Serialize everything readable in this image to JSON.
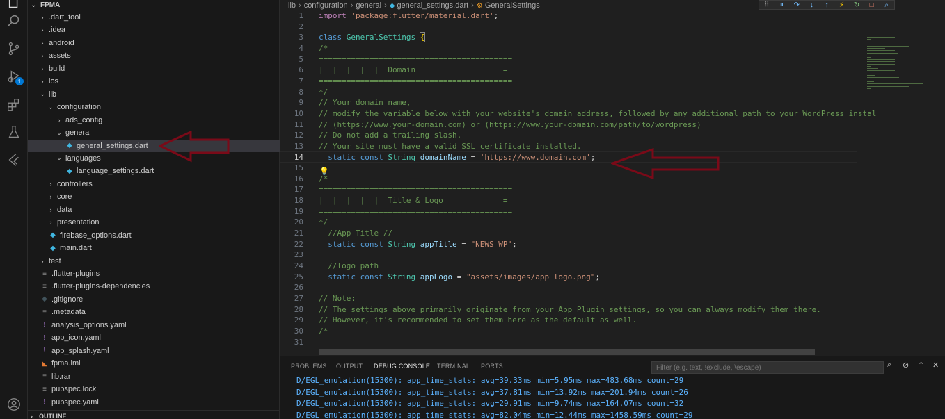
{
  "explorer": {
    "root": "FPMA",
    "outline_label": "OUTLINE",
    "items": [
      {
        "label": ".dart_tool",
        "type": "folder",
        "state": "collapsed",
        "depth": 1
      },
      {
        "label": ".idea",
        "type": "folder",
        "state": "collapsed",
        "depth": 1
      },
      {
        "label": "android",
        "type": "folder",
        "state": "collapsed",
        "depth": 1
      },
      {
        "label": "assets",
        "type": "folder",
        "state": "collapsed",
        "depth": 1
      },
      {
        "label": "build",
        "type": "folder",
        "state": "collapsed",
        "depth": 1
      },
      {
        "label": "ios",
        "type": "folder",
        "state": "collapsed",
        "depth": 1
      },
      {
        "label": "lib",
        "type": "folder",
        "state": "expanded",
        "depth": 1
      },
      {
        "label": "configuration",
        "type": "folder",
        "state": "expanded",
        "depth": 2
      },
      {
        "label": "ads_config",
        "type": "folder",
        "state": "collapsed",
        "depth": 3
      },
      {
        "label": "general",
        "type": "folder",
        "state": "expanded",
        "depth": 3
      },
      {
        "label": "general_settings.dart",
        "type": "dart",
        "depth": 4,
        "selected": true
      },
      {
        "label": "languages",
        "type": "folder",
        "state": "expanded",
        "depth": 3
      },
      {
        "label": "language_settings.dart",
        "type": "dart",
        "depth": 4
      },
      {
        "label": "controllers",
        "type": "folder",
        "state": "collapsed",
        "depth": 2
      },
      {
        "label": "core",
        "type": "folder",
        "state": "collapsed",
        "depth": 2
      },
      {
        "label": "data",
        "type": "folder",
        "state": "collapsed",
        "depth": 2
      },
      {
        "label": "presentation",
        "type": "folder",
        "state": "collapsed",
        "depth": 2
      },
      {
        "label": "firebase_options.dart",
        "type": "dart",
        "depth": 2
      },
      {
        "label": "main.dart",
        "type": "dart",
        "depth": 2
      },
      {
        "label": "test",
        "type": "folder",
        "state": "collapsed",
        "depth": 1
      },
      {
        "label": ".flutter-plugins",
        "type": "text",
        "depth": 1
      },
      {
        "label": ".flutter-plugins-dependencies",
        "type": "text",
        "depth": 1
      },
      {
        "label": ".gitignore",
        "type": "git",
        "depth": 1
      },
      {
        "label": ".metadata",
        "type": "text",
        "depth": 1
      },
      {
        "label": "analysis_options.yaml",
        "type": "yaml",
        "depth": 1
      },
      {
        "label": "app_icon.yaml",
        "type": "yaml",
        "depth": 1
      },
      {
        "label": "app_splash.yaml",
        "type": "yaml",
        "depth": 1
      },
      {
        "label": "fpma.iml",
        "type": "rss",
        "depth": 1
      },
      {
        "label": "lib.rar",
        "type": "text",
        "depth": 1
      },
      {
        "label": "pubspec.lock",
        "type": "text",
        "depth": 1
      },
      {
        "label": "pubspec.yaml",
        "type": "yaml",
        "depth": 1
      }
    ]
  },
  "breadcrumb": {
    "parts": [
      "lib",
      "configuration",
      "general",
      "general_settings.dart",
      "GeneralSettings"
    ]
  },
  "editor": {
    "active_line": 14,
    "lines": [
      [
        [
          "kw2",
          "import "
        ],
        [
          "str",
          "'package:flutter/material.dart'"
        ],
        [
          "pl",
          ";"
        ]
      ],
      [],
      [
        [
          "kw",
          "class "
        ],
        [
          "cls",
          "GeneralSettings "
        ],
        [
          "brk",
          "{"
        ]
      ],
      [
        [
          "cmt",
          "/*"
        ]
      ],
      [
        [
          "cmt",
          "=========================================="
        ]
      ],
      [
        [
          "cmt",
          "|  |  |  |  |  Domain                   ="
        ]
      ],
      [
        [
          "cmt",
          "=========================================="
        ]
      ],
      [
        [
          "cmt",
          "*/"
        ]
      ],
      [
        [
          "cmt",
          "// Your domain name,"
        ]
      ],
      [
        [
          "cmt",
          "// modify the variable below with your website's domain address, followed by any additional path to your WordPress instal"
        ]
      ],
      [
        [
          "cmt",
          "// (https://www.your-domain.com) or (https://www.your-domain.com/path/to/wordpress)"
        ]
      ],
      [
        [
          "cmt",
          "// Do not add a trailing slash."
        ]
      ],
      [
        [
          "cmt",
          "// Your site must have a valid SSL certificate installed."
        ]
      ],
      [
        [
          "pl",
          "  "
        ],
        [
          "kw",
          "static const "
        ],
        [
          "cls",
          "String "
        ],
        [
          "var",
          "domainName "
        ],
        [
          "pl",
          "= "
        ],
        [
          "str",
          "'https://www.domain.com'"
        ],
        [
          "pl",
          ";"
        ]
      ],
      [],
      [
        [
          "cmt",
          "/*"
        ]
      ],
      [
        [
          "cmt",
          "=========================================="
        ]
      ],
      [
        [
          "cmt",
          "|  |  |  |  |  Title & Logo             ="
        ]
      ],
      [
        [
          "cmt",
          "=========================================="
        ]
      ],
      [
        [
          "cmt",
          "*/"
        ]
      ],
      [
        [
          "cmt",
          "  //App Title //"
        ]
      ],
      [
        [
          "pl",
          "  "
        ],
        [
          "kw",
          "static const "
        ],
        [
          "cls",
          "String "
        ],
        [
          "var",
          "appTitle "
        ],
        [
          "pl",
          "= "
        ],
        [
          "str",
          "\"NEWS WP\""
        ],
        [
          "pl",
          ";"
        ]
      ],
      [],
      [
        [
          "cmt",
          "  //logo path"
        ]
      ],
      [
        [
          "pl",
          "  "
        ],
        [
          "kw",
          "static const "
        ],
        [
          "cls",
          "String "
        ],
        [
          "var",
          "appLogo "
        ],
        [
          "pl",
          "= "
        ],
        [
          "str",
          "\"assets/images/app_logo.png\""
        ],
        [
          "pl",
          ";"
        ]
      ],
      [],
      [
        [
          "cmt",
          "// Note:"
        ]
      ],
      [
        [
          "cmt",
          "// The settings above primarily originate from your App Plugin settings, so you can always modify them there."
        ]
      ],
      [
        [
          "cmt",
          "// However, it's recommended to set them here as the default as well."
        ]
      ],
      [
        [
          "cmt",
          "/*"
        ]
      ],
      []
    ]
  },
  "panel": {
    "tabs": [
      "PROBLEMS",
      "OUTPUT",
      "DEBUG CONSOLE",
      "TERMINAL",
      "PORTS"
    ],
    "active_tab": "DEBUG CONSOLE",
    "filter_placeholder": "Filter (e.g. text, !exclude, \\escape)",
    "console_lines": [
      "D/EGL_emulation(15300): app_time_stats: avg=39.33ms min=5.95ms max=483.68ms count=29",
      "D/EGL_emulation(15300): app_time_stats: avg=37.81ms min=13.92ms max=201.94ms count=26",
      "D/EGL_emulation(15300): app_time_stats: avg=29.91ms min=9.74ms max=164.07ms count=32",
      "D/EGL_emulation(15300): app_time_stats: avg=82.04ms min=12.44ms max=1458.59ms count=29"
    ]
  },
  "activity_bar": {
    "icons": [
      "explorer-icon",
      "search-icon",
      "source-control-icon",
      "run-debug-icon",
      "extensions-icon",
      "testing-icon",
      "flutter-icon",
      "account-icon"
    ],
    "debug_badge": "1"
  },
  "colors": {
    "accent": "#0078d4",
    "annotation_arrow": "#7a0a18",
    "dart_icon": "#40b6e0"
  }
}
